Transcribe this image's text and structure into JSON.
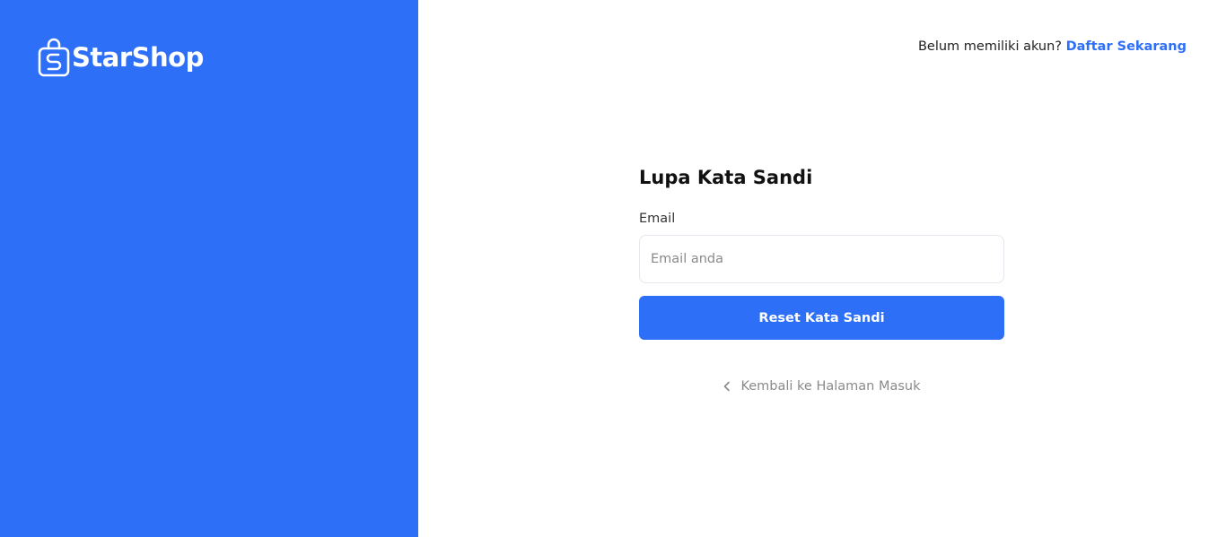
{
  "brand": {
    "name": "StarShop",
    "logo_icon": "shopping-bag-s-icon"
  },
  "header": {
    "prompt_text": "Belum memiliki akun?",
    "signup_link": "Daftar Sekarang"
  },
  "form": {
    "title": "Lupa Kata Sandi",
    "email_label": "Email",
    "email_placeholder": "Email anda",
    "email_value": "",
    "submit_label": "Reset Kata Sandi",
    "back_label": "Kembali ke Halaman Masuk",
    "back_icon": "chevron-left-icon"
  },
  "colors": {
    "primary": "#2e6ff8",
    "background": "#ffffff",
    "muted_text": "#8a8a8a"
  }
}
